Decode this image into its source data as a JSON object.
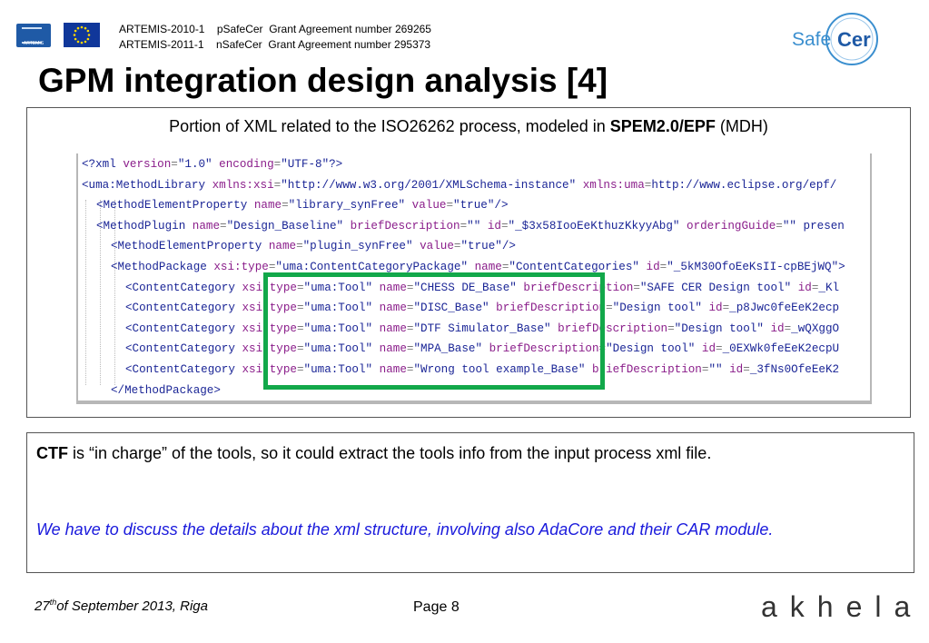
{
  "header": {
    "line1": {
      "project": "ARTEMIS-2010-1",
      "name": "pSafeCer",
      "grant": "Grant Agreement number 269265"
    },
    "line2": {
      "project": "ARTEMIS-2011-1",
      "name": "nSafeCer",
      "grant": "Grant Agreement number 295373"
    },
    "artemis_logo_text": "ARTEMIS",
    "safecer_logo": {
      "left": "Safe",
      "right": "Cer"
    }
  },
  "title": "GPM integration design analysis [4]",
  "caption": {
    "prefix": "Portion of XML related to the ISO26262 process, modeled in ",
    "bold": "SPEM2.0/EPF",
    "suffix": " (MDH)"
  },
  "xml_lines": [
    "<?xml version=\"1.0\" encoding=\"UTF-8\"?>",
    "<uma:MethodLibrary xmlns:xsi=\"http://www.w3.org/2001/XMLSchema-instance\" xmlns:uma=\"http://www.eclipse.org/epf/",
    "<MethodElementProperty name=\"library_synFree\" value=\"true\"/>",
    "<MethodPlugin name=\"Design_Baseline\" briefDescription=\"\" id=\"_$3x58IooEeKthuzKkyyAbg\" orderingGuide=\"\" presen",
    "<MethodElementProperty name=\"plugin_synFree\" value=\"true\"/>",
    "<MethodPackage xsi:type=\"uma:ContentCategoryPackage\" name=\"ContentCategories\" id=\"_5kM30OfoEeKsII-cpBEjWQ\">",
    "<ContentCategory xsi:type=\"uma:Tool\" name=\"CHESS DE_Base\" briefDescription=\"SAFE CER Design tool\" id=\"_Kl",
    "<ContentCategory xsi:type=\"uma:Tool\" name=\"DISC_Base\" briefDescription=\"Design tool\" id=\"_p8Jwc0feEeK2ecp",
    "<ContentCategory xsi:type=\"uma:Tool\" name=\"DTF Simulator_Base\" briefDescription=\"Design tool\" id=\"_wQXggO",
    "<ContentCategory xsi:type=\"uma:Tool\" name=\"MPA_Base\" briefDescription=\"Design tool\" id=\"_0EXWk0feEeK2ecpU",
    "<ContentCategory xsi:type=\"uma:Tool\" name=\"Wrong tool example_Base\" briefDescription=\"\" id=\"_3fNs0OfeEeK2",
    "</MethodPackage>"
  ],
  "xml_indents": [
    0,
    0,
    1,
    1,
    2,
    2,
    3,
    3,
    3,
    3,
    3,
    2
  ],
  "colors": {
    "tag": "#1a2596",
    "attr": "#8a1d8a",
    "value": "#1a2596",
    "highlight_box": "#12a84a",
    "note_text": "#1a1adc"
  },
  "note": {
    "bold": "CTF",
    "text": " is “in charge” of the tools, so it could extract the tools info from the input process xml file.",
    "italic": "We have to discuss the details about the xml structure, involving also AdaCore and their CAR module."
  },
  "footer": {
    "date_day": "27",
    "date_sup": "th",
    "date_rest": "of September 2013, Riga",
    "page": "Page 8",
    "logo": "akhela"
  }
}
